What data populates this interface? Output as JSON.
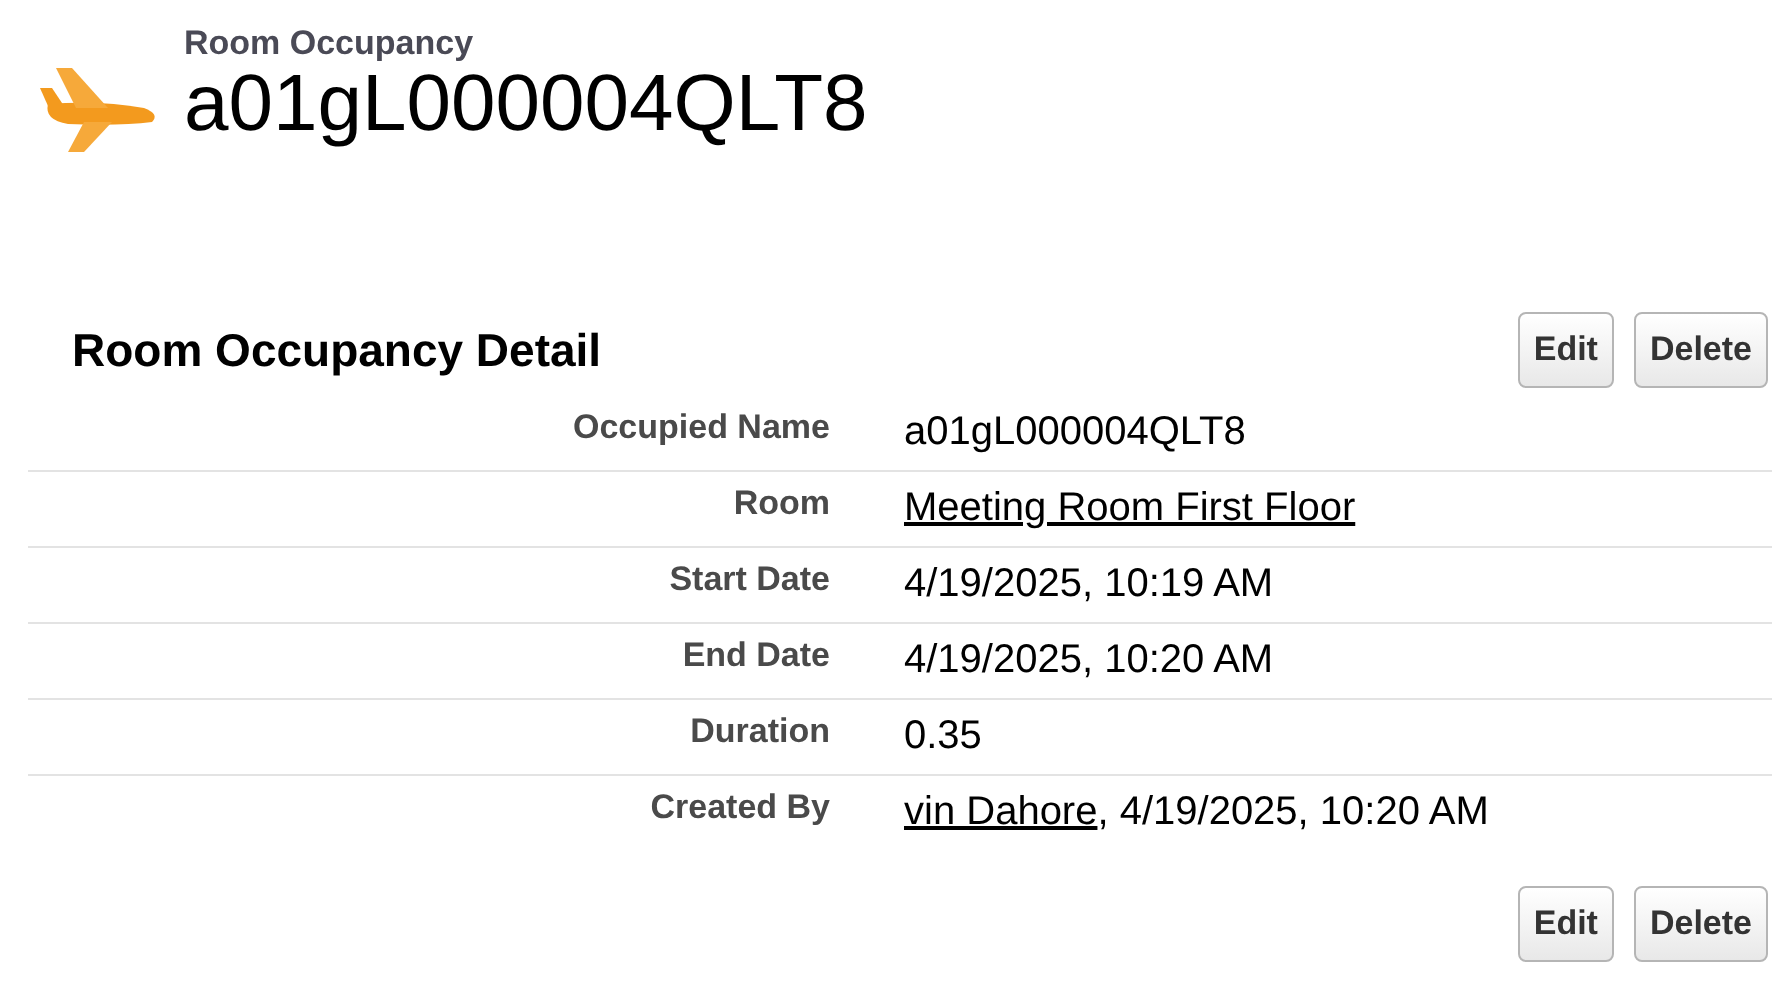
{
  "header": {
    "object_type": "Room Occupancy",
    "record_name": "a01gL000004QLT8"
  },
  "detail": {
    "title": "Room Occupancy Detail",
    "top_buttons": [
      "Edit",
      "Delete"
    ],
    "fields": [
      {
        "label": "Occupied Name",
        "parts": [
          {
            "text": "a01gL000004QLT8",
            "link": false
          }
        ]
      },
      {
        "label": "Room",
        "parts": [
          {
            "text": "Meeting Room First Floor",
            "link": true
          }
        ]
      },
      {
        "label": "Start Date",
        "parts": [
          {
            "text": "4/19/2025, 10:19 AM",
            "link": false
          }
        ]
      },
      {
        "label": "End Date",
        "parts": [
          {
            "text": "4/19/2025, 10:20 AM",
            "link": false
          }
        ]
      },
      {
        "label": "Duration",
        "parts": [
          {
            "text": "0.35",
            "link": false
          }
        ]
      },
      {
        "label": "Created By",
        "parts": [
          {
            "text": "vin Dahore",
            "link": true
          },
          {
            "text": ", 4/19/2025, 10:20 AM",
            "link": false
          }
        ]
      }
    ],
    "bottom_buttons": [
      "Edit",
      "Delete"
    ]
  }
}
